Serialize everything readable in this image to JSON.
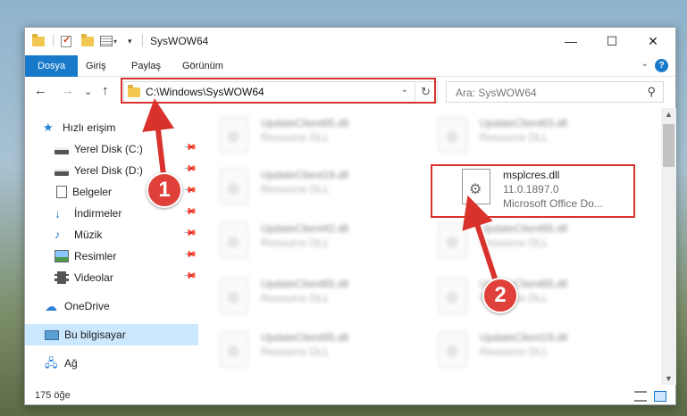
{
  "window": {
    "title": "SysWOW64",
    "controls": {
      "minimize": "—",
      "maximize": "☐",
      "close": "✕"
    }
  },
  "ribbon": {
    "tabs": [
      "Dosya",
      "Giriş",
      "Paylaş",
      "Görünüm"
    ],
    "help": "?"
  },
  "nav": {
    "back": "←",
    "forward": "→",
    "recent": "⌄",
    "up": "↑",
    "address": "C:\\Windows\\SysWOW64",
    "refresh": "↻",
    "search_placeholder": "Ara: SysWOW64"
  },
  "sidebar": {
    "items": [
      {
        "label": "Hızlı erişim",
        "icon": "star-icon",
        "pinned": false
      },
      {
        "label": "Yerel Disk (C:)",
        "icon": "drive-icon",
        "pinned": true
      },
      {
        "label": "Yerel Disk (D:)",
        "icon": "drive-icon",
        "pinned": true
      },
      {
        "label": "Belgeler",
        "icon": "documents-icon",
        "pinned": true
      },
      {
        "label": "İndirmeler",
        "icon": "download-icon",
        "pinned": true
      },
      {
        "label": "Müzik",
        "icon": "music-icon",
        "pinned": true
      },
      {
        "label": "Resimler",
        "icon": "pictures-icon",
        "pinned": true
      },
      {
        "label": "Videolar",
        "icon": "videos-icon",
        "pinned": true
      },
      {
        "label": "OneDrive",
        "icon": "cloud-icon",
        "pinned": false
      },
      {
        "label": "Bu bilgisayar",
        "icon": "computer-icon",
        "pinned": false,
        "selected": true
      },
      {
        "label": "Ağ",
        "icon": "network-icon",
        "pinned": false
      }
    ],
    "pin_glyph": "📌"
  },
  "files": [
    {
      "name": "UpdateClient65.dll",
      "type": "Resource DLL",
      "blurred": true
    },
    {
      "name": "UpdateClient63.dll",
      "type": "Resource DLL",
      "blurred": true
    },
    {
      "name": "UpdateClient19.dll",
      "type": "Resource DLL",
      "blurred": true
    },
    {
      "name": "msplcres.dll",
      "version": "11.0.1897.0",
      "type": "Microsoft Office Do...",
      "blurred": false
    },
    {
      "name": "UpdateClient42.dll",
      "type": "Resource DLL",
      "blurred": true
    },
    {
      "name": "UpdateClient65.dll",
      "type": "Resource DLL",
      "blurred": true
    },
    {
      "name": "UpdateClient65.dll",
      "type": "Resource DLL",
      "blurred": true
    },
    {
      "name": "UpdateClient65.dll",
      "type": "Resource DLL",
      "blurred": true
    },
    {
      "name": "UpdateClient65.dll",
      "type": "Resource DLL",
      "blurred": true
    },
    {
      "name": "UpdateClient19.dll",
      "type": "Resource DLL",
      "blurred": true
    }
  ],
  "status": {
    "count": "175 öğe"
  },
  "annotations": {
    "step1": "1",
    "step2": "2",
    "color": "#d9322c"
  }
}
